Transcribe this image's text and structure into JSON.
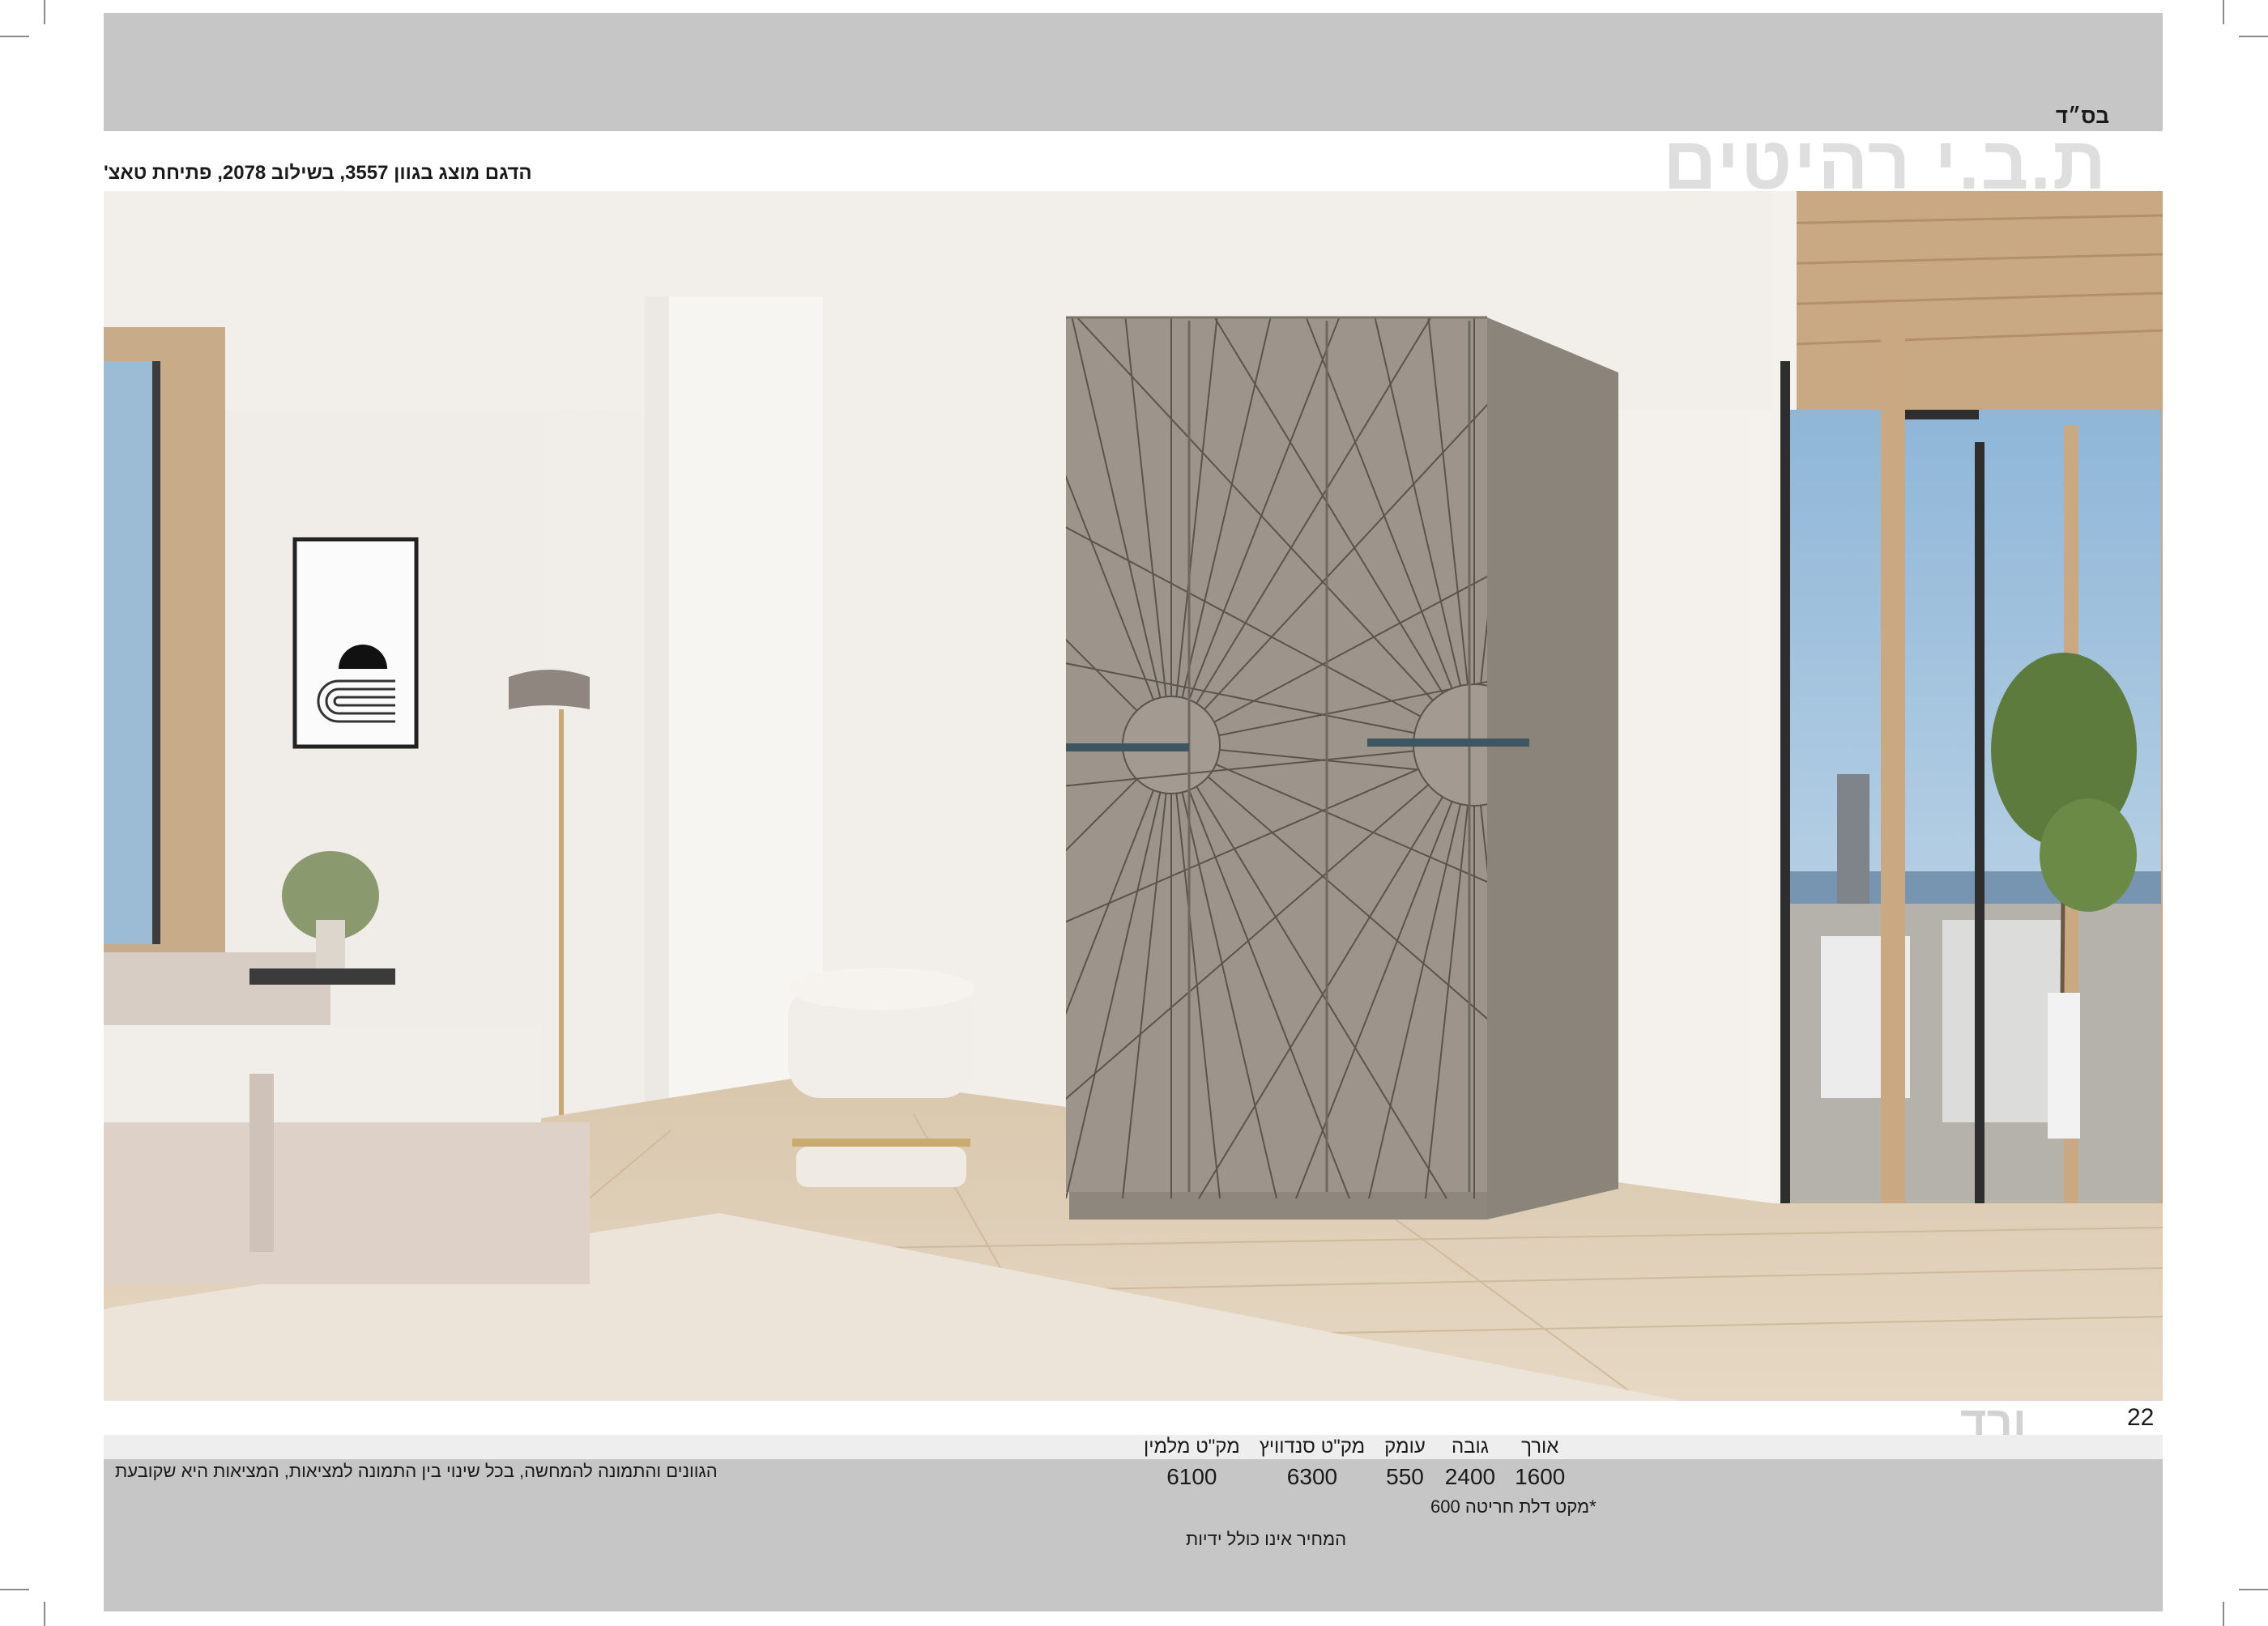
{
  "header": {
    "bsd": "בס״ד",
    "brand": "ת.ב.י רהיטים",
    "caption": "הדגם מוצג בגוון 3557, בשילוב 2078, פתיחת טאצ'"
  },
  "footer": {
    "model_name": "ורד",
    "page_number": "22",
    "disclaimer": "הגוונים והתמונה להמחשה, בכל שינוי בין התמונה למציאות, המציאות היא שקובעת",
    "spec_headers": [
      "אורך",
      "גובה",
      "עומק",
      "מק\"ט סנדוויץ",
      "מק\"ט מלמין"
    ],
    "spec_values": [
      "1600",
      "2400",
      "550",
      "6300",
      "6100"
    ],
    "note_door": "*מקט דלת חריטה 600",
    "note_handles": "המחיר אינו כולל ידיות"
  },
  "colors": {
    "band_gray": "#c6c6c6",
    "wardrobe": "#9d958b",
    "handle": "#3d5660",
    "wood": "#c9a983"
  }
}
